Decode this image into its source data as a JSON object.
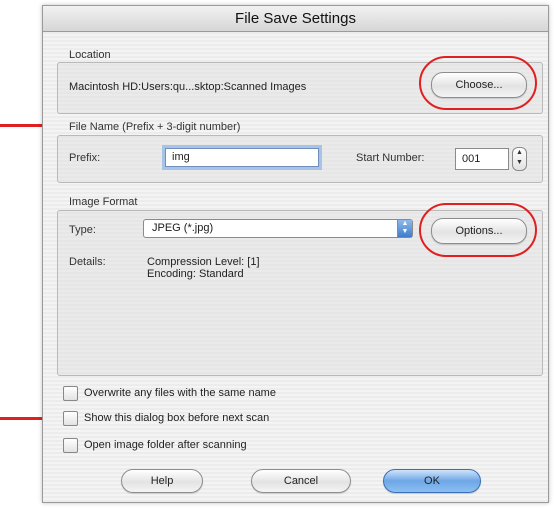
{
  "dialog": {
    "title": "File Save Settings"
  },
  "location": {
    "group_label": "Location",
    "path": "Macintosh HD:Users:qu...sktop:Scanned Images",
    "choose_label": "Choose..."
  },
  "file_name": {
    "group_label": "File Name (Prefix + 3-digit number)",
    "prefix_label": "Prefix:",
    "prefix_value": "img",
    "start_number_label": "Start Number:",
    "start_number_value": "001"
  },
  "image_format": {
    "group_label": "Image Format",
    "type_label": "Type:",
    "type_value": "JPEG (*.jpg)",
    "options_label": "Options...",
    "details_label": "Details:",
    "details_line1": "Compression Level: [1]",
    "details_line2": "Encoding: Standard"
  },
  "checkboxes": [
    {
      "label": "Overwrite any files with the same name",
      "checked": false
    },
    {
      "label": "Show this dialog box before next scan",
      "checked": false
    },
    {
      "label": "Open image folder after scanning",
      "checked": false
    }
  ],
  "buttons": {
    "help": "Help",
    "cancel": "Cancel",
    "ok": "OK"
  },
  "colors": {
    "annotation": "#e02020",
    "focus_ring": "#a7c3e6",
    "primary_button": "#6ea6e6"
  }
}
